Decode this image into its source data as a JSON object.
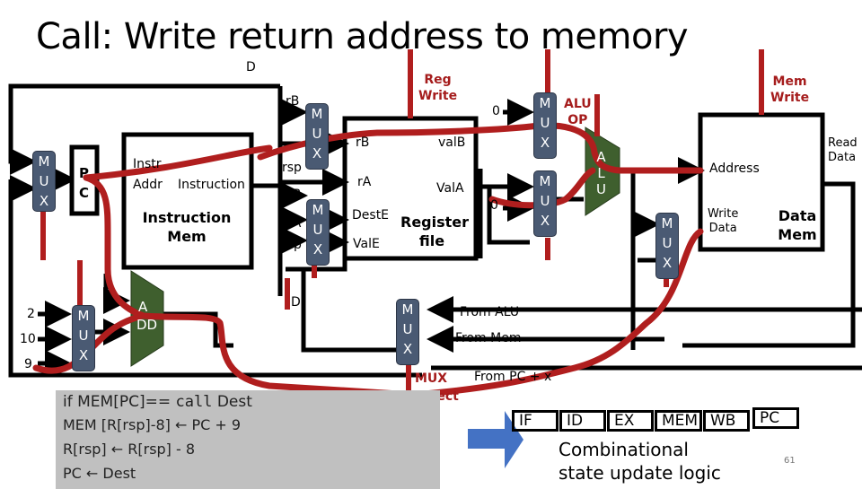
{
  "slide": {
    "title": "Call: Write return address to memory",
    "page_number": "61"
  },
  "labels": {
    "d_top": "D",
    "d_bottom": "D",
    "pc_mux": [
      "M",
      "U",
      "X"
    ],
    "pc_reg": [
      "P",
      "C"
    ],
    "instr_mem": {
      "port_addr_1": "Instr",
      "port_addr_2": "Addr",
      "port_out": "Instruction",
      "name_1": "Instruction",
      "name_2": "Mem"
    },
    "pc_inc_inputs": [
      "2",
      "10",
      "9"
    ],
    "pc_inc_mux": [
      "M",
      "U",
      "X"
    ],
    "adder": [
      "A",
      "DD"
    ],
    "reg_write": [
      "Reg",
      "Write"
    ],
    "srcB_mux_inputs": [
      "rB",
      "rsp"
    ],
    "srcB_mux": [
      "M",
      "U",
      "X"
    ],
    "dst_mux_inputs": [
      "rB",
      "rA",
      "rsp"
    ],
    "dst_mux": [
      "M",
      "U",
      "X"
    ],
    "reg_file": {
      "port_rB": "rB",
      "port_rA": "rA",
      "port_destE": "DestE",
      "port_valE": "ValE",
      "port_valB": "valB",
      "port_valA": "ValA",
      "name_1": "Register",
      "name_2": "file"
    },
    "alu_a_zero": "0",
    "alu_a_mux": [
      "M",
      "U",
      "X"
    ],
    "alu_b_zero": "0",
    "alu_b_mux": [
      "M",
      "U",
      "X"
    ],
    "alu_op": [
      "ALU",
      "OP"
    ],
    "alu": [
      "A",
      "L",
      "U"
    ],
    "mem_write": [
      "Mem",
      "Write"
    ],
    "data_mem": {
      "port_address": "Address",
      "port_write_1": "Write",
      "port_write_2": "Data",
      "port_read_1": "Read",
      "port_read_2": "Data",
      "name_1": "Data",
      "name_2": "Mem"
    },
    "wdata_mux": [
      "M",
      "U",
      "X"
    ],
    "wb_mux": [
      "M",
      "U",
      "X"
    ],
    "wb_inputs": [
      "From ALU",
      "From Mem",
      "From PC + x"
    ],
    "mux_select": [
      "MUX",
      "Select"
    ]
  },
  "code": {
    "line1_prefix": "if MEM[PC]== ",
    "line1_keyword": "call",
    "line1_suffix": " Dest",
    "line2": "MEM [R[rsp]-8] ← PC + 9",
    "line3": "R[rsp] ← R[rsp] - 8",
    "line4": "PC ← Dest"
  },
  "pipeline": {
    "stages": [
      "IF",
      "ID",
      "EX",
      "MEM",
      "WB",
      "PC"
    ],
    "caption_1": "Combinational",
    "caption_2": "state update logic"
  },
  "colors": {
    "path_highlight": "#b01e1e",
    "control_text": "#a51c1c",
    "mux_fill": "#4a5a73",
    "alu_fill": "#3f5f2e",
    "code_bg": "#c0c0c0",
    "arrow_blue": "#4472c4"
  }
}
